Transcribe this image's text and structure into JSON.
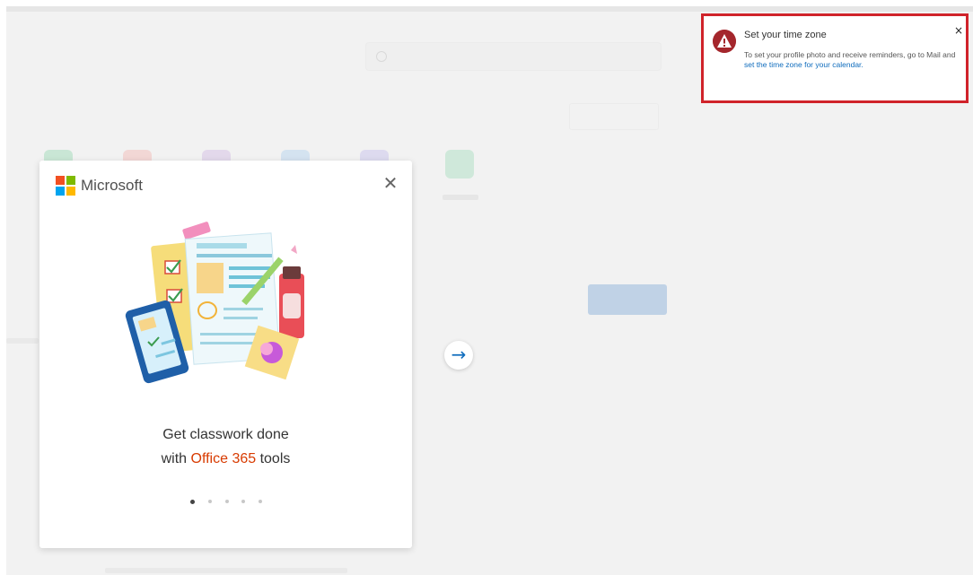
{
  "modal": {
    "brand": "Microsoft",
    "close_icon": "close-icon",
    "headline_line1": "Get classwork done",
    "headline_pre": "with ",
    "headline_accent": "Office 365",
    "headline_post": " tools",
    "slide_count": 5,
    "active_slide": 1,
    "colors": {
      "accent": "#d83b01",
      "logo_red": "#f25022",
      "logo_green": "#7fba00",
      "logo_blue": "#00a4ef",
      "logo_yellow": "#ffb900"
    }
  },
  "carousel": {
    "next_icon": "arrow-right-icon"
  },
  "notification": {
    "title": "Set your time zone",
    "body": "To set your profile photo and receive reminders, go to Mail and",
    "link": "set the time zone for your calendar.",
    "icon": "warning-icon",
    "close_glyph": "×",
    "colors": {
      "border": "#d0232a",
      "icon_bg": "#a4262c",
      "link": "#0f6cbd"
    }
  }
}
